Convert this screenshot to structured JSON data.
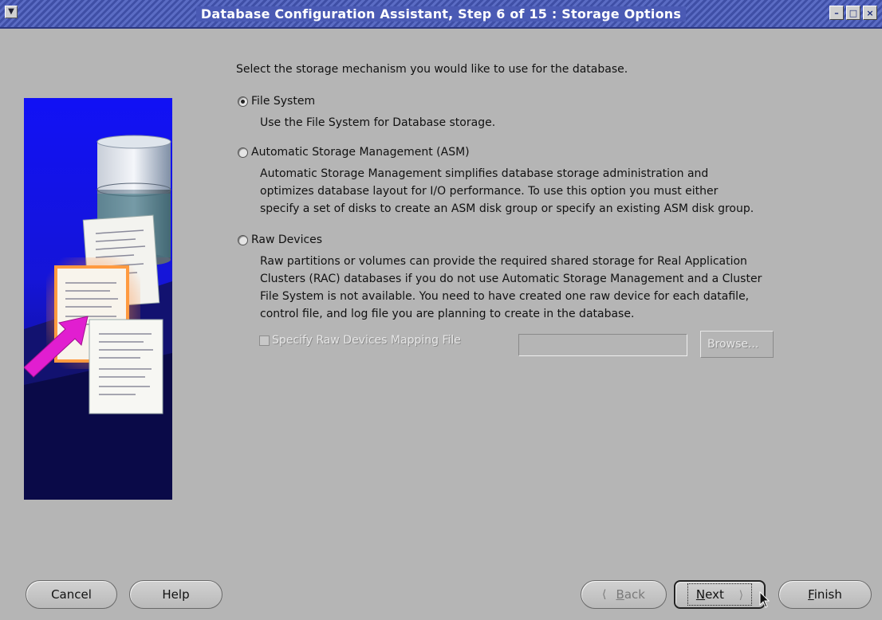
{
  "window": {
    "title": "Database Configuration Assistant, Step 6 of 15 : Storage Options",
    "controls": [
      "minimize-icon",
      "maximize-icon",
      "close-icon"
    ]
  },
  "instruction": "Select the storage mechanism you would like to use for the database.",
  "options": [
    {
      "label": "File System",
      "selected": true,
      "description": [
        "Use the File System for Database storage."
      ]
    },
    {
      "label": "Automatic Storage Management (ASM)",
      "selected": false,
      "description": [
        "Automatic Storage Management simplifies database storage administration and",
        "optimizes database layout for I/O performance. To use this option you must either",
        "specify a set of disks to create an ASM disk group or specify an existing ASM disk group."
      ]
    },
    {
      "label": "Raw Devices",
      "selected": false,
      "description": [
        "Raw partitions or volumes can provide the required shared storage for Real Application",
        "Clusters (RAC) databases if you do not use Automatic Storage Management and a Cluster",
        "File System is not available.  You need to have created one raw device for each datafile,",
        "control file, and log file you are planning to create in the database."
      ]
    }
  ],
  "raw_mapping": {
    "checkbox_label": "Specify Raw Devices Mapping File",
    "checked": false,
    "enabled": false,
    "field_value": "",
    "browse_label": "Browse..."
  },
  "buttons": {
    "cancel": "Cancel",
    "help": "Help",
    "back_prefix": "B",
    "back_rest": "ack",
    "next_prefix": "N",
    "next_rest": "ext",
    "finish_prefix": "F",
    "finish_rest": "inish"
  },
  "colors": {
    "background": "#b5b5b5",
    "titlebar": "#4a5ab4",
    "illustration_blue": "#1010f0"
  }
}
